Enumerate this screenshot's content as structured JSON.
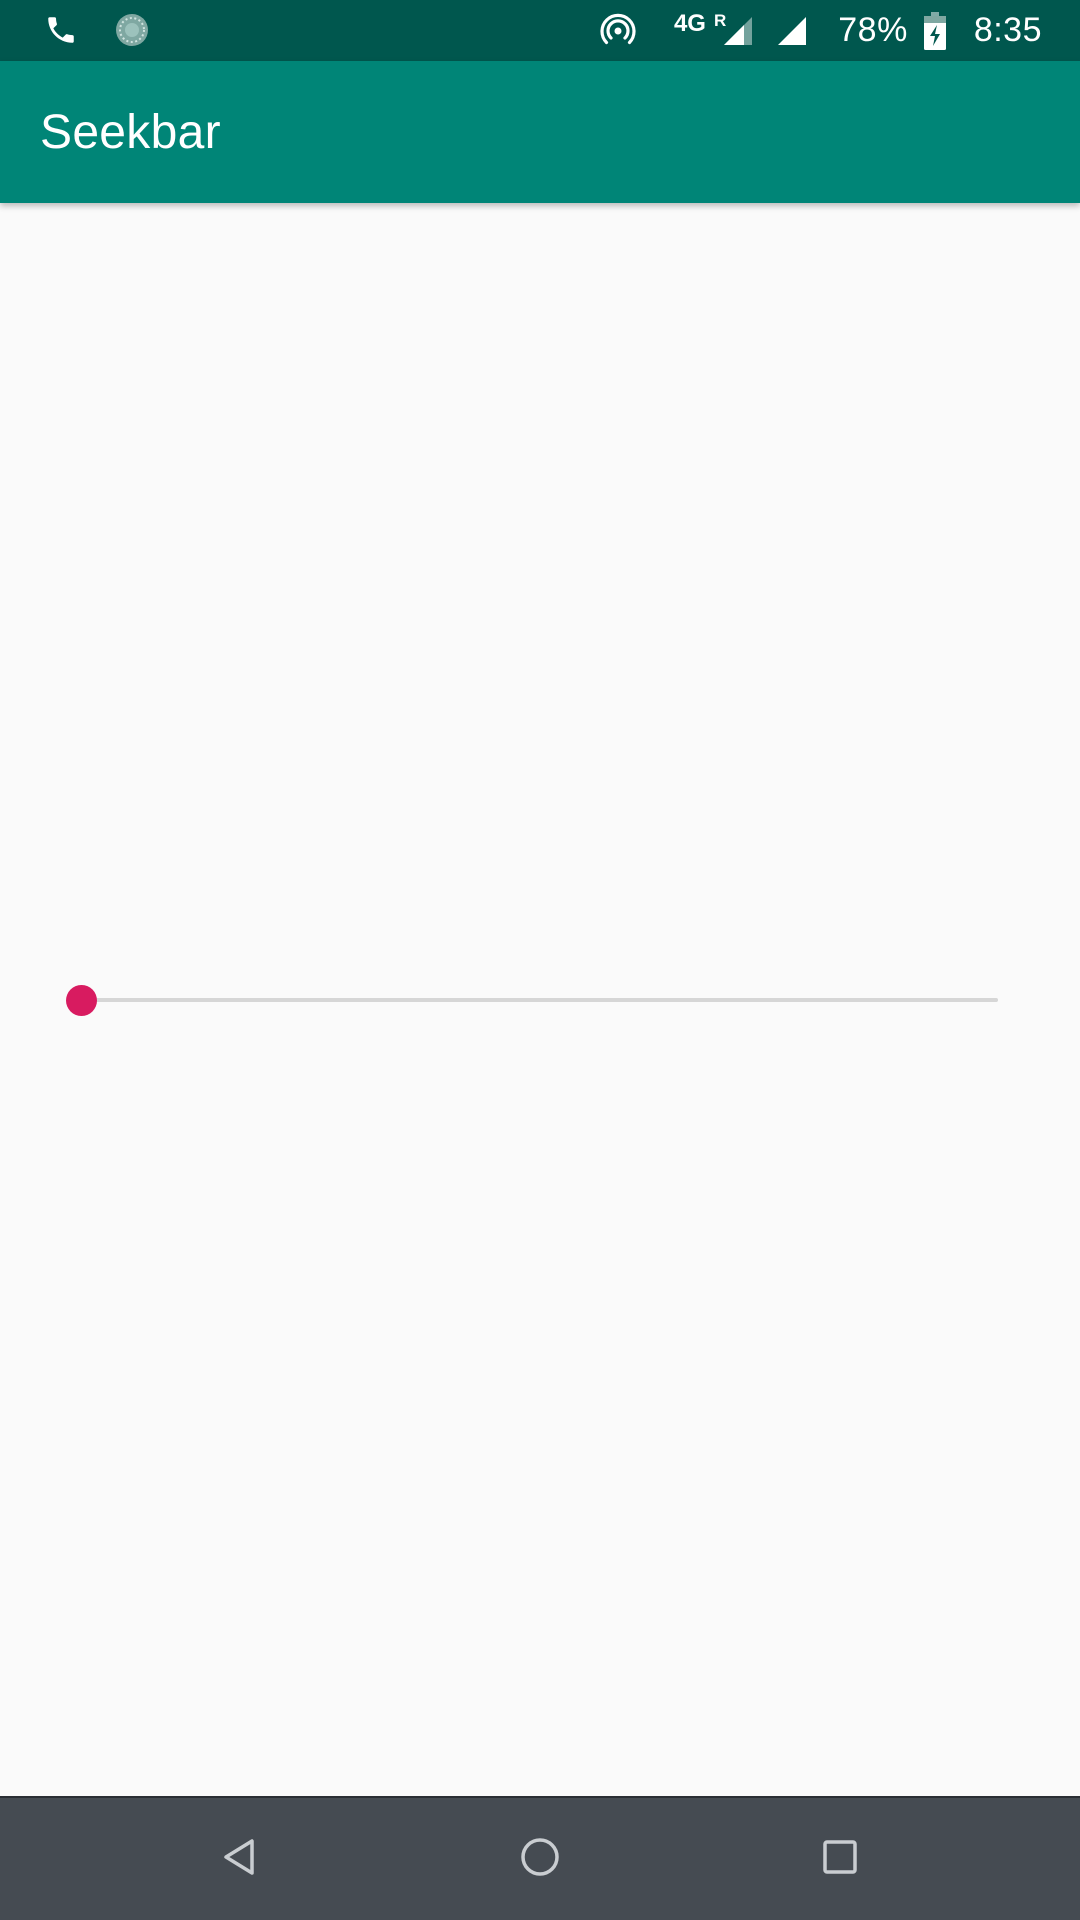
{
  "status_bar": {
    "left_icons": [
      "phone-icon",
      "sync-status-icon"
    ],
    "right_icons": [
      "hotspot-icon",
      "signal-roaming-icon",
      "signal-icon",
      "battery-charging-icon"
    ],
    "network_type": "4G",
    "roaming_indicator": "R",
    "battery_percent": "78%",
    "time": "8:35"
  },
  "app_bar": {
    "title": "Seekbar"
  },
  "seekbar": {
    "progress": 0,
    "max": 100
  },
  "nav_bar": {
    "buttons": [
      "back-icon",
      "home-icon",
      "recents-icon"
    ]
  },
  "colors": {
    "status_bar": "#00574e",
    "app_bar": "#008577",
    "accent": "#d81b60",
    "track": "#d6d6d6",
    "background": "#fafafa",
    "nav_bar": "#454b52"
  }
}
